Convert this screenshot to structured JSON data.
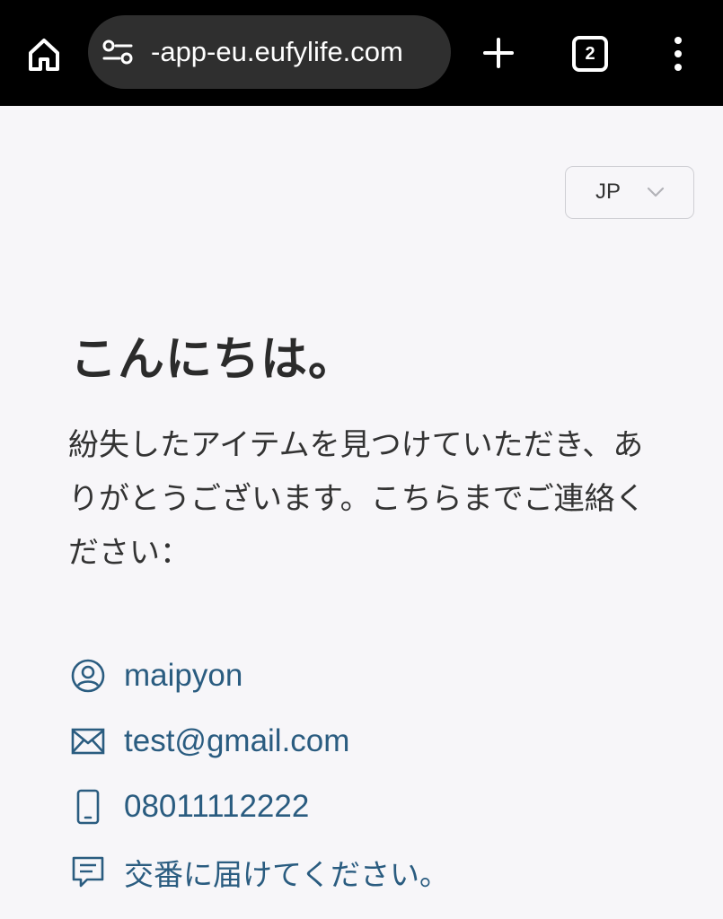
{
  "browser": {
    "url": "-app-eu.eufylife.com",
    "tab_count": "2"
  },
  "language": {
    "selected": "JP"
  },
  "page": {
    "greeting": "こんにちは。",
    "message": "紛失したアイテムを見つけていただき、ありがとうございます。こちらまでご連絡ください："
  },
  "contacts": [
    {
      "icon": "user-circle-icon",
      "value": "maipyon"
    },
    {
      "icon": "mail-icon",
      "value": "test@gmail.com"
    },
    {
      "icon": "phone-icon",
      "value": "08011112222"
    },
    {
      "icon": "message-icon",
      "value": "交番に届けてください。"
    }
  ],
  "colors": {
    "browser_bar": "#000000",
    "url_pill": "#2f2f2f",
    "page_background": "#f7f6f9",
    "contact_text": "#2a5c80",
    "heading_text": "#2b2b2b"
  }
}
